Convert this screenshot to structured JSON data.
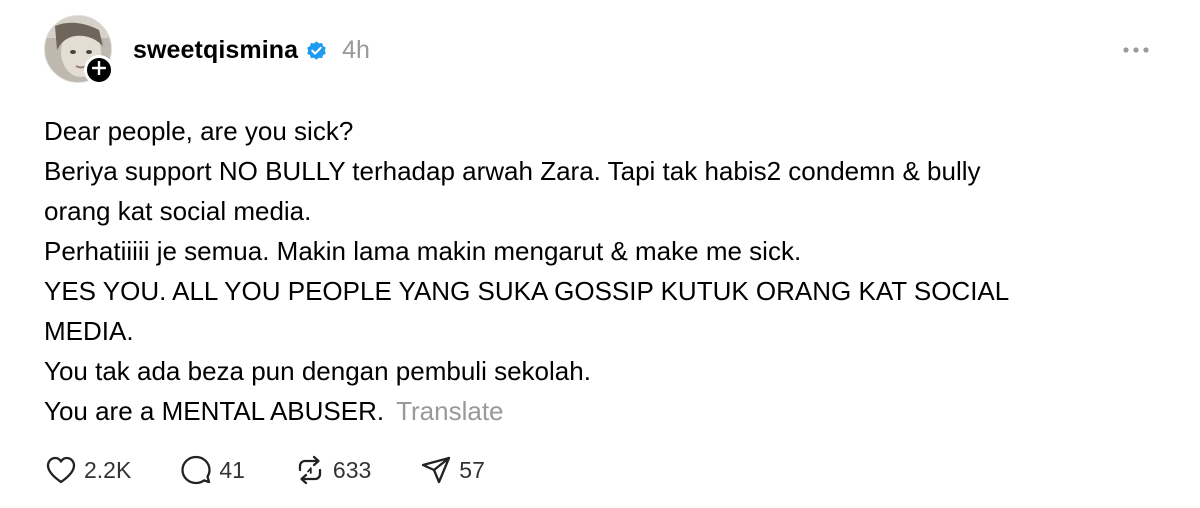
{
  "post": {
    "username": "sweetqismina",
    "timestamp": "4h",
    "lines": [
      "Dear people, are you sick?",
      "Beriya support NO BULLY terhadap arwah Zara. Tapi tak habis2 condemn & bully",
      "orang kat social media.",
      "Perhatiiiii je semua. Makin lama makin mengarut & make me sick.",
      "YES YOU. ALL YOU PEOPLE YANG SUKA GOSSIP KUTUK ORANG KAT SOCIAL",
      "MEDIA.",
      "You tak ada beza pun dengan pembuli sekolah.",
      "You are a MENTAL ABUSER."
    ],
    "translate_label": "Translate",
    "actions": {
      "likes": "2.2K",
      "replies": "41",
      "reposts": "633",
      "shares": "57"
    }
  },
  "icons": {
    "verified": "verified-badge-icon",
    "follow": "plus-icon",
    "more": "more-horizontal-icon",
    "like": "heart-icon",
    "reply": "speech-bubble-icon",
    "repost": "repost-icon",
    "share": "send-icon"
  },
  "colors": {
    "verified_blue": "#1D9BF0",
    "muted_text": "#999999"
  }
}
